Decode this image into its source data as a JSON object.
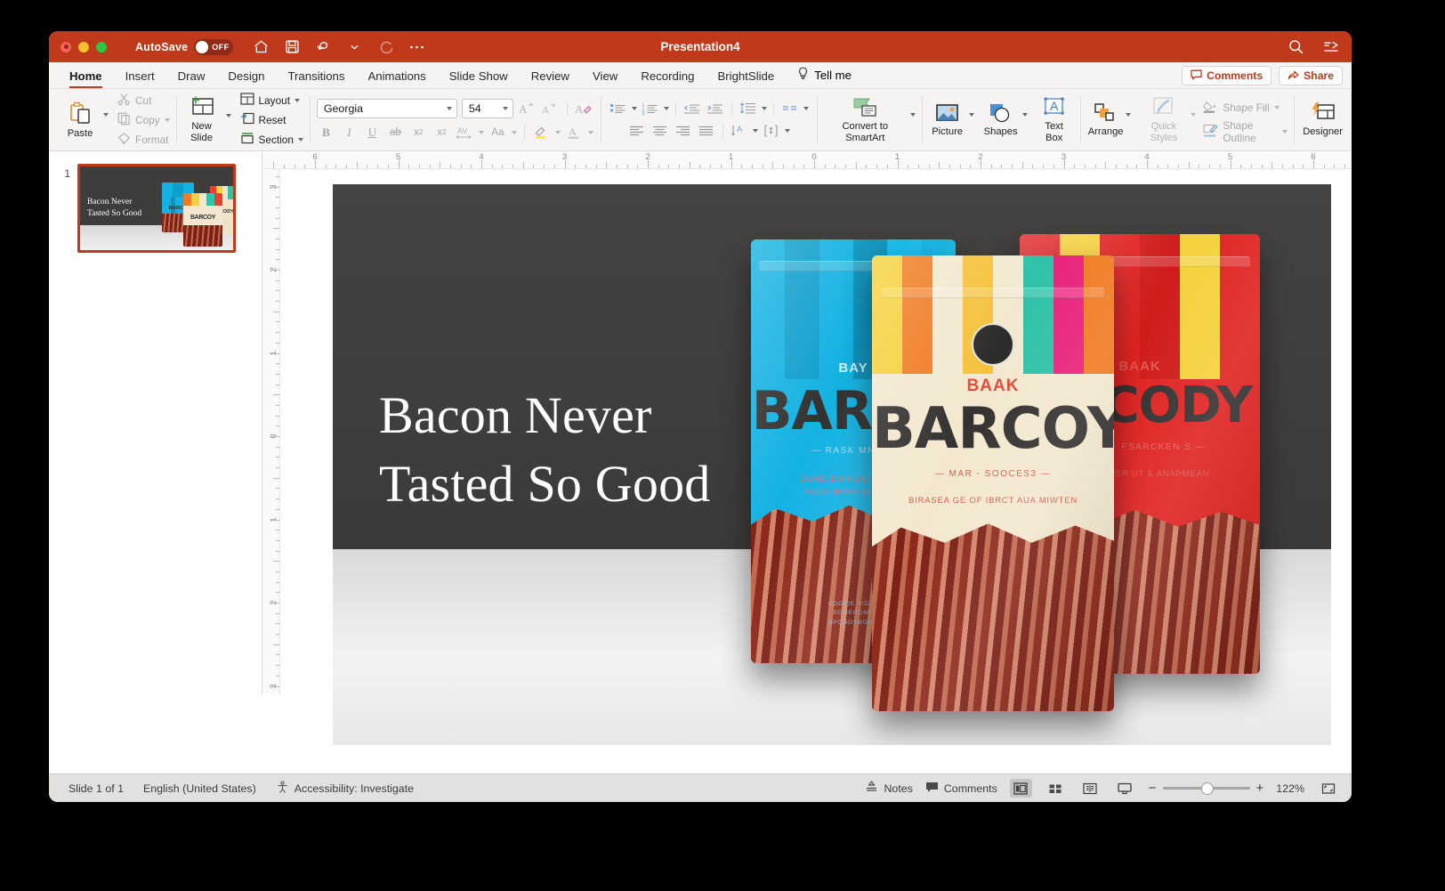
{
  "window": {
    "title": "Presentation4",
    "autosave_label": "AutoSave",
    "autosave_state": "OFF",
    "quick_access": [
      "home-icon",
      "save-icon",
      "undo-icon",
      "undo-chevron",
      "redo-icon",
      "more-icon"
    ],
    "search_icon": "search-icon",
    "ribbon_options_icon": "ribbon-display-options-icon"
  },
  "tabs": [
    {
      "label": "Home",
      "active": true
    },
    {
      "label": "Insert",
      "active": false
    },
    {
      "label": "Draw",
      "active": false
    },
    {
      "label": "Design",
      "active": false
    },
    {
      "label": "Transitions",
      "active": false
    },
    {
      "label": "Animations",
      "active": false
    },
    {
      "label": "Slide Show",
      "active": false
    },
    {
      "label": "Review",
      "active": false
    },
    {
      "label": "View",
      "active": false
    },
    {
      "label": "Recording",
      "active": false
    },
    {
      "label": "BrightSlide",
      "active": false
    }
  ],
  "tell_me": {
    "label": "Tell me",
    "icon": "lightbulb-icon"
  },
  "tab_actions": {
    "comments": {
      "label": "Comments",
      "icon": "comment-icon"
    },
    "share": {
      "label": "Share",
      "icon": "share-icon"
    }
  },
  "ribbon": {
    "clipboard": {
      "paste": "Paste",
      "cut": "Cut",
      "copy": "Copy",
      "format": "Format"
    },
    "slides": {
      "new_slide": "New Slide",
      "layout": "Layout",
      "reset": "Reset",
      "section": "Section"
    },
    "font": {
      "name": "Georgia",
      "size": "54",
      "grow_icon": "increase-font-size-icon",
      "shrink_icon": "decrease-font-size-icon",
      "clear_icon": "clear-formatting-icon",
      "bold": "B",
      "italic": "I",
      "underline": "U",
      "strikethrough": "ab",
      "superscript": "x²",
      "subscript": "x₂",
      "spacing_icon": "character-spacing-icon",
      "case_icon": "change-case-icon",
      "highlight_icon": "text-highlight-icon",
      "fontcolor_icon": "font-color-icon"
    },
    "paragraph": {
      "bullets_icon": "bullets-icon",
      "numbering_icon": "numbering-icon",
      "decrease_indent_icon": "decrease-indent-icon",
      "increase_indent_icon": "increase-indent-icon",
      "line_spacing_icon": "line-spacing-icon",
      "columns_icon": "columns-icon",
      "align_left_icon": "align-left-icon",
      "align_center_icon": "align-center-icon",
      "align_right_icon": "align-right-icon",
      "justify_icon": "justify-icon",
      "text_direction_icon": "text-direction-icon",
      "align_text_icon": "align-text-icon",
      "convert_smartart": "Convert to SmartArt"
    },
    "drawing": {
      "picture": "Picture",
      "shapes": "Shapes",
      "text_box": "Text Box",
      "arrange": "Arrange",
      "quick_styles": "Quick Styles",
      "shape_fill": "Shape Fill",
      "shape_outline": "Shape Outline"
    },
    "designer": {
      "label": "Designer",
      "icon": "designer-icon"
    }
  },
  "thumbnails": [
    {
      "number": "1",
      "title": "Bacon Never\nTasted So Good",
      "selected": true
    }
  ],
  "ruler": {
    "horizontal_ticks": [
      "6",
      "5",
      "4",
      "3",
      "2",
      "1",
      "0",
      "1",
      "2",
      "3",
      "4",
      "5",
      "6"
    ],
    "vertical_ticks": [
      "3",
      "2",
      "1",
      "0",
      "1",
      "2",
      "3"
    ]
  },
  "slide": {
    "title_line1": "Bacon Never",
    "title_line2": "Tasted So Good",
    "title_font": "Georgia",
    "title_size": "54",
    "background_top": "#3d3c3a",
    "background_bottom": "#ececec",
    "image_alt": "three-bacon-snack-packages",
    "packages": [
      {
        "name": "blue-package",
        "accent": "#1eb4e0",
        "brand": "BARCO",
        "brand_small": "BAY",
        "tagline": "RASK MNL",
        "body_line1": "SOME DUHIOO A ORTO",
        "body_line2": "SAGE ROVHIOMAA M"
      },
      {
        "name": "cream-package",
        "accent": "#f2e6cc",
        "brand": "BARCOY",
        "brand_small": "BAAK",
        "tagline": "MAR - SOOCES3",
        "body_line1": "BIRASEA GE OF IBRCT AUA MIWTEN"
      },
      {
        "name": "red-package",
        "accent": "#e02322",
        "brand": "ARCODY",
        "brand_small": "BAAK",
        "tagline": "ANE - FSARCKEN S",
        "body_line1": "ON TIEBNER UT & ANAPMEAN"
      }
    ]
  },
  "status": {
    "slide_count": "Slide 1 of 1",
    "language": "English (United States)",
    "accessibility": "Accessibility: Investigate",
    "notes": "Notes",
    "comments": "Comments",
    "zoom_level": "122%",
    "zoom_out": "−",
    "zoom_in": "+",
    "views": [
      "normal-view-icon",
      "slide-sorter-icon",
      "reading-view-icon",
      "slide-show-icon"
    ],
    "fit_icon": "fit-to-window-icon"
  },
  "colors": {
    "accent": "#c0391b",
    "ribbon_bg": "#f5f4f3",
    "status_bg": "#e3e1df"
  }
}
